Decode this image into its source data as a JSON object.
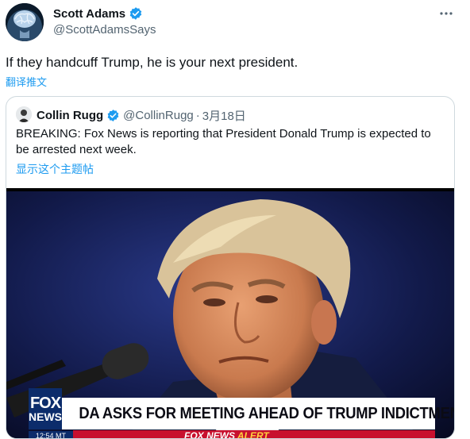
{
  "tweet": {
    "author_name": "Scott Adams",
    "author_handle": "@ScottAdamsSays",
    "text": "If they handcuff Trump, he is your next president.",
    "translate_label": "翻译推文"
  },
  "quoted_tweet": {
    "author_name": "Collin Rugg",
    "author_handle": "@CollinRugg",
    "separator": "·",
    "date": "3月18日",
    "text": "BREAKING: Fox News is reporting that President Donald Trump is expected to be arrested next week.",
    "show_thread_label": "显示这个主题帖",
    "media": {
      "chyron_logo_line1": "FOX",
      "chyron_logo_line2": "NEWS",
      "chyron_headline": "DA ASKS FOR MEETING AHEAD OF TRUMP INDICTMENT",
      "clock": "12:54 MT",
      "alert_prefix": "FOX NEWS",
      "alert_word": "ALERT"
    }
  },
  "icons": {
    "verified": "verified-badge-icon",
    "more": "more-options-icon"
  },
  "colors": {
    "link": "#1d9bf0",
    "secondary_text": "#536471",
    "fox_blue": "#0c2c6b",
    "alert_red": "#c8102e"
  }
}
